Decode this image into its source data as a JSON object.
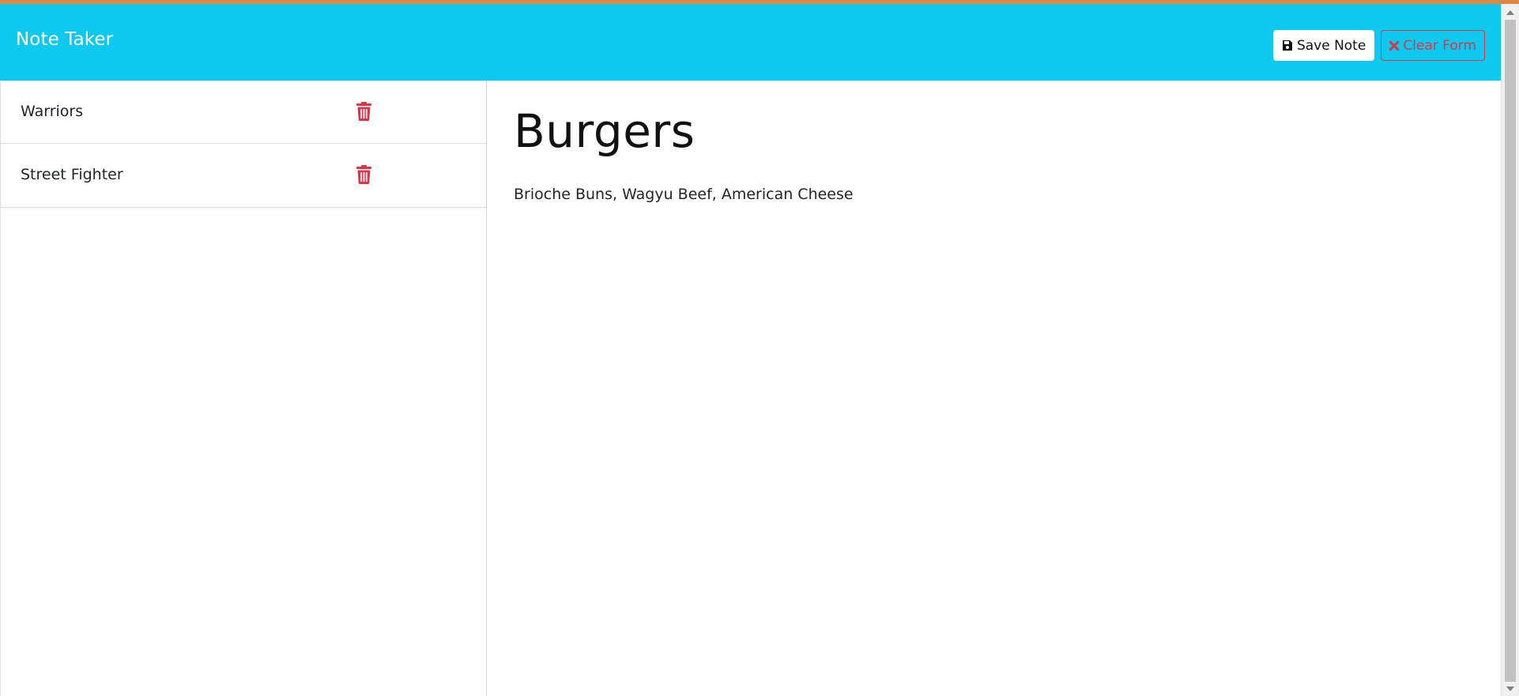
{
  "app": {
    "brand": "Note Taker"
  },
  "toolbar": {
    "save_label": "Save Note",
    "clear_label": "Clear Form"
  },
  "sidebar": {
    "notes": [
      {
        "title": "Warriors"
      },
      {
        "title": "Street Fighter"
      }
    ]
  },
  "active_note": {
    "title": "Burgers",
    "text": "Brioche Buns, Wagyu Beef, American Cheese"
  },
  "icons": {
    "save": "floppy-disk-icon",
    "clear": "x-mark-icon",
    "delete": "trash-icon"
  },
  "colors": {
    "accent_bar": "#e2873d",
    "navbar": "#0ec9ef",
    "danger": "#dc3545"
  }
}
